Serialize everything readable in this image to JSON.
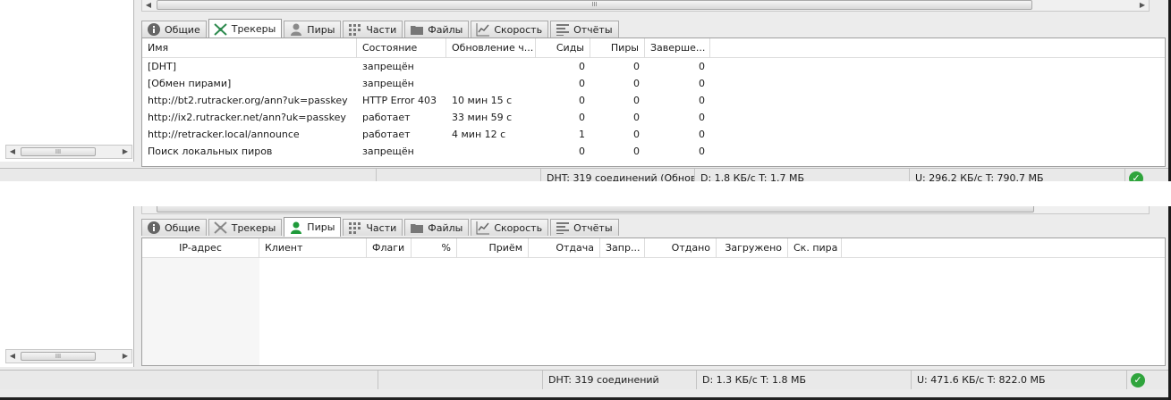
{
  "tabs": [
    {
      "label": "Общие",
      "icon": "info-icon"
    },
    {
      "label": "Трекеры",
      "icon": "trackers-icon"
    },
    {
      "label": "Пиры",
      "icon": "peers-icon"
    },
    {
      "label": "Части",
      "icon": "pieces-icon"
    },
    {
      "label": "Файлы",
      "icon": "folder-icon"
    },
    {
      "label": "Скорость",
      "icon": "speed-chart-icon"
    },
    {
      "label": "Отчёты",
      "icon": "log-icon"
    }
  ],
  "trackers_view": {
    "active_tab": "Трекеры",
    "columns": [
      "Имя",
      "Состояние",
      "Обновление ч...",
      "Сиды",
      "Пиры",
      "Заверше..."
    ],
    "rows": [
      [
        "[DHT]",
        "запрещён",
        "",
        "0",
        "0",
        "0"
      ],
      [
        "[Обмен пирами]",
        "запрещён",
        "",
        "0",
        "0",
        "0"
      ],
      [
        "http://bt2.rutracker.org/ann?uk=passkey",
        "HTTP Error 403",
        "10 мин 15 с",
        "0",
        "0",
        "0"
      ],
      [
        "http://ix2.rutracker.net/ann?uk=passkey",
        "работает",
        "33 мин 59 с",
        "0",
        "0",
        "0"
      ],
      [
        "http://retracker.local/announce",
        "работает",
        "4 мин 12 с",
        "1",
        "0",
        "0"
      ],
      [
        "Поиск локальных пиров",
        "запрещён",
        "",
        "0",
        "0",
        "0"
      ]
    ],
    "status": {
      "dht": "DHT: 319 соединений (Обнов",
      "download": "D: 1.8 КБ/с T: 1.7 МБ",
      "upload": "U: 296.2 КБ/с T: 790.7 МБ"
    }
  },
  "peers_view": {
    "active_tab": "Пиры",
    "columns": [
      "IP-адрес",
      "Клиент",
      "Флаги",
      "%",
      "Приём",
      "Отдача",
      "Запр...",
      "Отдано",
      "Загружено",
      "Ск. пира"
    ],
    "rows": [],
    "status": {
      "dht": "DHT: 319 соединений",
      "download": "D: 1.3 КБ/с T: 1.8 МБ",
      "upload": "U: 471.6 КБ/с T: 822.0 МБ"
    }
  },
  "colors": {
    "accent_green": "#2fa43c",
    "peer_icon_green": "#1f9a3a",
    "tracker_icon_green": "#2d8a4e"
  }
}
